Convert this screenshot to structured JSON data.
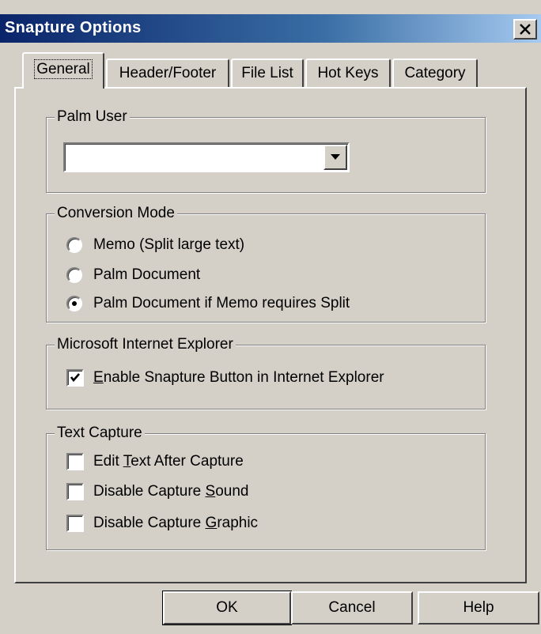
{
  "window": {
    "title": "Snapture Options",
    "close_icon": "close-icon"
  },
  "tabs": [
    {
      "label": "General",
      "active": true
    },
    {
      "label": "Header/Footer",
      "active": false
    },
    {
      "label": "File List",
      "active": false
    },
    {
      "label": "Hot Keys",
      "active": false
    },
    {
      "label": "Category",
      "active": false
    }
  ],
  "palm_user": {
    "legend": "Palm User",
    "value": ""
  },
  "conversion_mode": {
    "legend": "Conversion Mode",
    "options": [
      {
        "label": "Memo (Split large text)",
        "selected": false
      },
      {
        "label": "Palm Document",
        "selected": false
      },
      {
        "label": "Palm Document if Memo requires Split",
        "selected": true
      }
    ]
  },
  "ie": {
    "legend": "Microsoft Internet Explorer",
    "enable_label_mn": "E",
    "enable_label_rest": "nable Snapture Button in Internet Explorer",
    "enable_checked": true
  },
  "text_capture": {
    "legend": "Text Capture",
    "edit_pre": "Edit ",
    "edit_mn": "T",
    "edit_post": "ext After Capture",
    "edit_checked": false,
    "sound_pre": "Disable Capture ",
    "sound_mn": "S",
    "sound_post": "ound",
    "sound_checked": false,
    "graphic_pre": "Disable Capture ",
    "graphic_mn": "G",
    "graphic_post": "raphic",
    "graphic_checked": false
  },
  "buttons": {
    "ok": "OK",
    "cancel": "Cancel",
    "help": "Help"
  }
}
